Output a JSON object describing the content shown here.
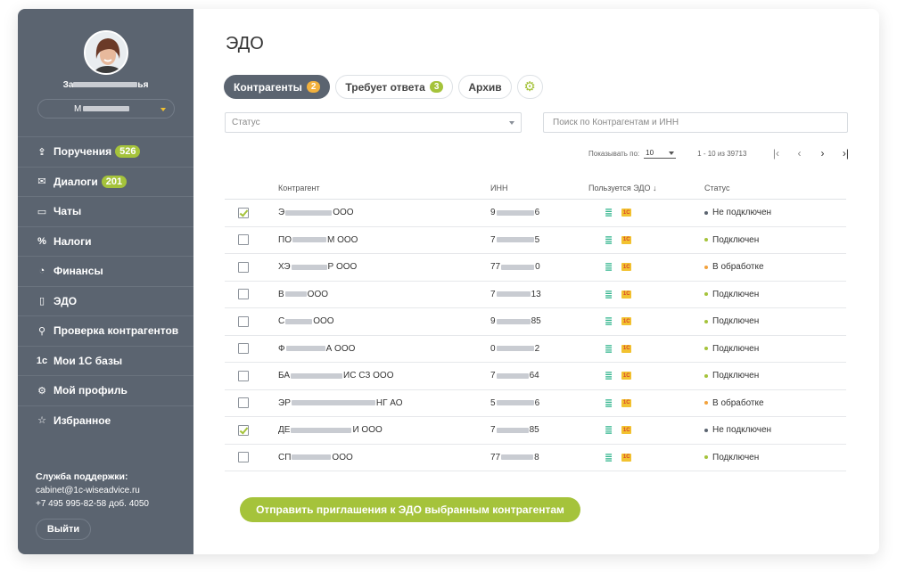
{
  "sidebar": {
    "user_name_start": "За",
    "user_name_end": "ья",
    "company_initial": "М",
    "nav": [
      {
        "label": "Поручения",
        "icon": "upload-icon",
        "glyph": "⇪",
        "badge": "526"
      },
      {
        "label": "Диалоги",
        "icon": "mail-icon",
        "glyph": "✉",
        "badge": "201"
      },
      {
        "label": "Чаты",
        "icon": "chat-icon",
        "glyph": "▭",
        "badge": ""
      },
      {
        "label": "Налоги",
        "icon": "percent-icon",
        "glyph": "%",
        "badge": ""
      },
      {
        "label": "Финансы",
        "icon": "clock-icon",
        "glyph": "◔",
        "badge": ""
      },
      {
        "label": "ЭДО",
        "icon": "document-icon",
        "glyph": "▯",
        "badge": ""
      },
      {
        "label": "Проверка контрагентов",
        "icon": "search-icon",
        "glyph": "⚲",
        "badge": ""
      },
      {
        "label": "Мои 1С базы",
        "icon": "1c-icon",
        "glyph": "1c",
        "badge": ""
      },
      {
        "label": "Мой профиль",
        "icon": "gear-icon",
        "glyph": "⚙",
        "badge": ""
      },
      {
        "label": "Избранное",
        "icon": "star-icon",
        "glyph": "☆",
        "badge": ""
      }
    ],
    "support_title": "Служба поддержки:",
    "support_email": "cabinet@1c-wiseadvice.ru",
    "support_phone": "+7 495 995-82-58 доб. 4050",
    "logout_label": "Выйти"
  },
  "main": {
    "title": "ЭДО",
    "tabs": [
      {
        "label": "Контрагенты",
        "count": "2",
        "color": "orange",
        "active": true
      },
      {
        "label": "Требует ответа",
        "count": "3",
        "color": "green",
        "active": false
      },
      {
        "label": "Архив",
        "count": "",
        "color": "",
        "active": false
      }
    ],
    "status_placeholder": "Статус",
    "search_placeholder": "Поиск по Контрагентам и ИНН",
    "pager": {
      "per_page_label": "Показывать по:",
      "per_page_value": "10",
      "range": "1 - 10 из 39713"
    },
    "columns": {
      "name": "Контрагент",
      "inn": "ИНН",
      "edo": "Пользуется ЭДО",
      "status": "Статус"
    },
    "rows": [
      {
        "checked": true,
        "name_start": "Э",
        "name_end": " ООО",
        "mask_w": 52,
        "inn_start": "9",
        "inn_end": "6",
        "inn_mask": 42,
        "status": "Не подключен",
        "status_color": "grey"
      },
      {
        "checked": false,
        "name_start": "ПО",
        "name_end": "М ООО",
        "mask_w": 38,
        "inn_start": "7",
        "inn_end": "5",
        "inn_mask": 42,
        "status": "Подключен",
        "status_color": "green"
      },
      {
        "checked": false,
        "name_start": "ХЭ",
        "name_end": "Р ООО",
        "mask_w": 40,
        "inn_start": "77",
        "inn_end": "0",
        "inn_mask": 37,
        "status": "В обработке",
        "status_color": "orange"
      },
      {
        "checked": false,
        "name_start": "В",
        "name_end": " ООО",
        "mask_w": 24,
        "inn_start": "7",
        "inn_end": "13",
        "inn_mask": 38,
        "status": "Подключен",
        "status_color": "green"
      },
      {
        "checked": false,
        "name_start": "С",
        "name_end": " ООО",
        "mask_w": 30,
        "inn_start": "9",
        "inn_end": "85",
        "inn_mask": 38,
        "status": "Подключен",
        "status_color": "green"
      },
      {
        "checked": false,
        "name_start": "Ф",
        "name_end": "А ООО",
        "mask_w": 44,
        "inn_start": "0",
        "inn_end": "2",
        "inn_mask": 42,
        "status": "Подключен",
        "status_color": "green"
      },
      {
        "checked": false,
        "name_start": "БА",
        "name_end": "ИС СЗ ООО",
        "mask_w": 58,
        "inn_start": "7",
        "inn_end": "64",
        "inn_mask": 36,
        "status": "Подключен",
        "status_color": "green"
      },
      {
        "checked": false,
        "name_start": "ЭР",
        "name_end": "НГ АО",
        "mask_w": 94,
        "inn_start": "5",
        "inn_end": "6",
        "inn_mask": 42,
        "status": "В обработке",
        "status_color": "orange"
      },
      {
        "checked": true,
        "name_start": "ДЕ",
        "name_end": "И ООО",
        "mask_w": 68,
        "inn_start": "7",
        "inn_end": "85",
        "inn_mask": 36,
        "status": "Не подключен",
        "status_color": "grey"
      },
      {
        "checked": false,
        "name_start": "СП",
        "name_end": " ООО",
        "mask_w": 44,
        "inn_start": "77",
        "inn_end": "8",
        "inn_mask": 36,
        "status": "Подключен",
        "status_color": "green"
      }
    ],
    "send_button": "Отправить приглашения к ЭДО выбранным контрагентам"
  },
  "colors": {
    "sidebar_bg": "#5b6470",
    "accent_green": "#a5c33b",
    "accent_orange": "#f2b13d"
  }
}
